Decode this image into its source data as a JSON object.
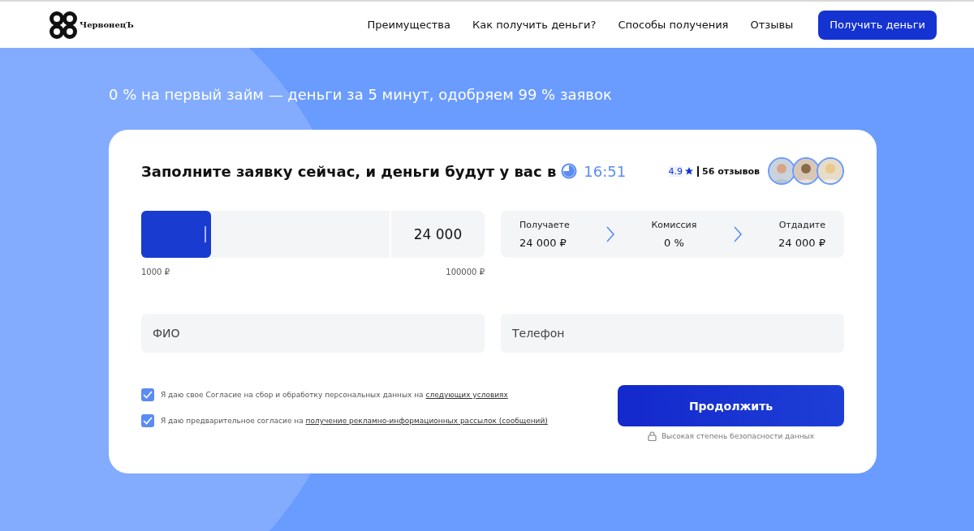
{
  "header": {
    "logo_text": "ЧервонецЪ",
    "nav": [
      "Преимущества",
      "Как получить деньги?",
      "Способы получения",
      "Отзывы"
    ],
    "cta": "Получить деньги"
  },
  "headline": "0 % на первый займ — деньги за 5 минут, одобряем 99 % заявок",
  "card": {
    "title": "Заполните заявку сейчас, и деньги будут у вас в",
    "time": "16:51",
    "rating": "4.9",
    "reviews": "56 отзывов",
    "amount": {
      "level": 0.28,
      "value": "24 000",
      "min": "1000 ₽",
      "max": "100000 ₽"
    },
    "summary": [
      {
        "label": "Получаете",
        "value": "24 000 ₽"
      },
      {
        "label": "Комиссия",
        "value": "0 %"
      },
      {
        "label": "Отдадите",
        "value": "24 000 ₽"
      }
    ],
    "fields": [
      {
        "placeholder": "ФИО"
      },
      {
        "placeholder": "Телефон"
      }
    ],
    "consents": [
      {
        "text": "Я даю свое Согласие на сбор и обработку персональных данных на",
        "link": "следующих условиях",
        "checked": true
      },
      {
        "text": "Я даю предварительное согласие на",
        "link": "получение рекламно-информационных рассылок (сообщений)",
        "checked": true
      }
    ],
    "submit": "Продолжить",
    "security": "Высокая степень безопасности данных"
  }
}
